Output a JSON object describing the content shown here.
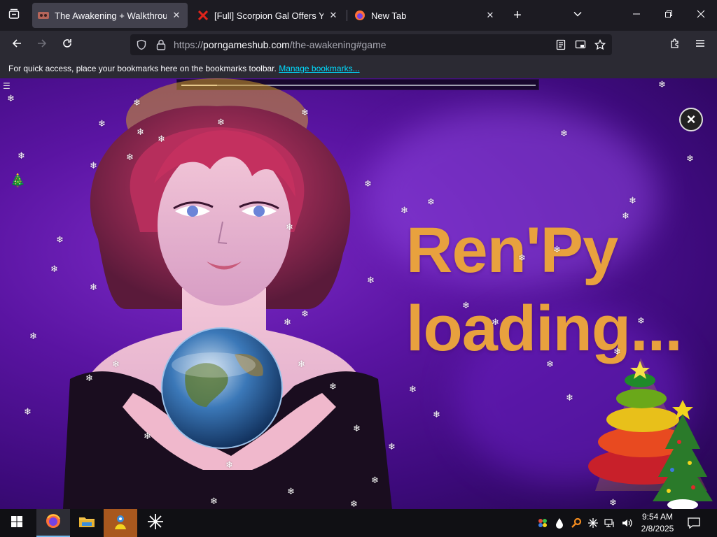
{
  "browser": {
    "tabs": [
      {
        "title": "The Awakening + Walkthrough",
        "active": true
      },
      {
        "title": "[Full] Scorpion Gal Offers You A",
        "active": false
      },
      {
        "title": "New Tab",
        "active": false
      }
    ],
    "url_prefix": "https://",
    "url_host": "porngameshub.com",
    "url_path": "/the-awakening#game",
    "bookmarks_text": "For quick access, place your bookmarks here on the bookmarks toolbar.",
    "bookmarks_link": "Manage bookmarks..."
  },
  "game": {
    "loading_line1": "Ren'Py",
    "loading_line2": "loading...",
    "progress_fraction": 0.1,
    "close_symbol": "×",
    "menu_symbol": "☰"
  },
  "taskbar": {
    "time": "9:54 AM",
    "date": "2/8/2025"
  },
  "icons": {
    "snowflake": "❄",
    "tree": "🎄"
  },
  "colors": {
    "accent": "#00ddff",
    "loading_text": "#e8a13e",
    "taskbar_active": "#76b9ed"
  }
}
